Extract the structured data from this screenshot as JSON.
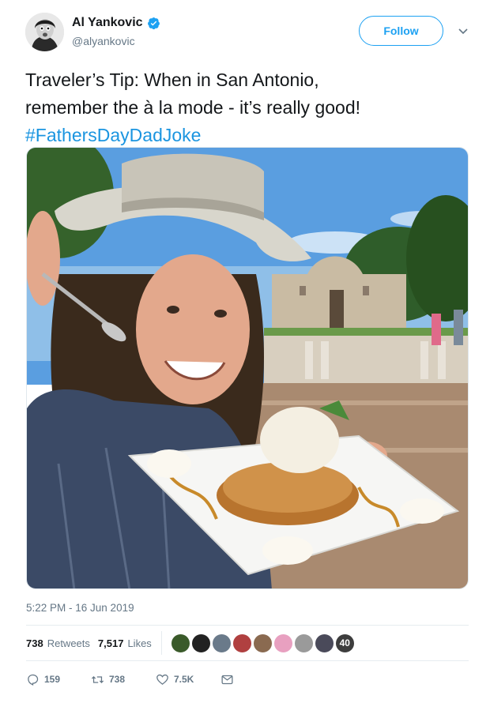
{
  "user": {
    "display_name": "Al Yankovic",
    "handle": "@alyankovic",
    "verified_icon": "verified-badge-icon"
  },
  "follow_button": "Follow",
  "tweet": {
    "line1": "Traveler’s Tip: When in San Antonio,",
    "line2": "remember the à la mode - it’s really good!",
    "hashtag": "#FathersDayDadJoke"
  },
  "timestamp": "5:22 PM - 16 Jun 2019",
  "stats": {
    "retweets_count": "738",
    "retweets_label": "Retweets",
    "likes_count": "7,517",
    "likes_label": "Likes",
    "liker_extra_count": "40"
  },
  "actions": {
    "reply_count": "159",
    "retweet_count": "738",
    "like_count": "7.5K"
  },
  "colors": {
    "accent": "#1da1f2",
    "hashtag": "#1b95e0",
    "muted": "#657786"
  }
}
